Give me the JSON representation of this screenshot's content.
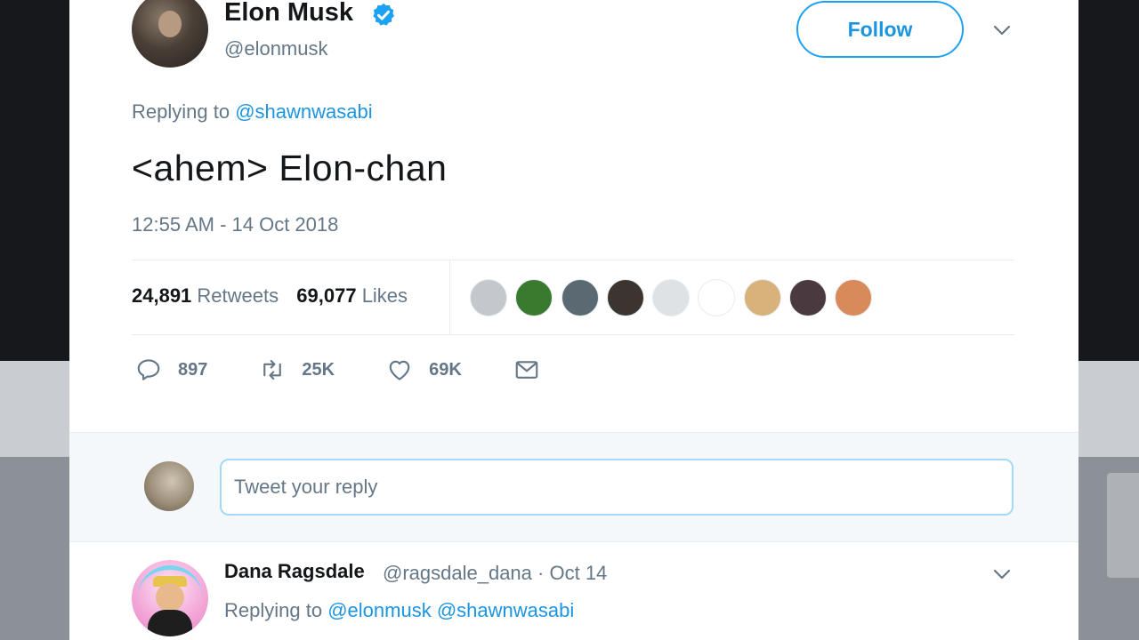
{
  "tweet": {
    "author_name": "Elon Musk",
    "author_handle": "@elonmusk",
    "follow_label": "Follow",
    "replying_prefix": "Replying to",
    "replying_to": "@shawnwasabi",
    "text": "<ahem> Elon-chan",
    "timestamp": "12:55 AM - 14 Oct 2018",
    "retweets_count": "24,891",
    "retweets_label": "Retweets",
    "likes_count": "69,077",
    "likes_label": "Likes",
    "reply_count": "897",
    "retweet_action_count": "25K",
    "like_action_count": "69K"
  },
  "likers": [
    {
      "color": "#c4c8cc"
    },
    {
      "color": "#3a7a2e"
    },
    {
      "color": "#5b6a72"
    },
    {
      "color": "#3b342f"
    },
    {
      "color": "#dfe2e5"
    },
    {
      "color": "#ffffff"
    },
    {
      "color": "#d8b27a"
    },
    {
      "color": "#4a3a40"
    },
    {
      "color": "#d98a5a"
    }
  ],
  "reply_box": {
    "placeholder": "Tweet your reply"
  },
  "reply": {
    "author_name": "Dana Ragsdale",
    "author_handle": "@ragsdale_dana",
    "separator": "·",
    "date": "Oct 14",
    "replying_prefix": "Replying to",
    "mention_1": "@elonmusk",
    "mention_2": "@shawnwasabi"
  },
  "colors": {
    "accent": "#1da1f2",
    "link": "#1b95e0",
    "text": "#14171a",
    "muted": "#657786"
  }
}
